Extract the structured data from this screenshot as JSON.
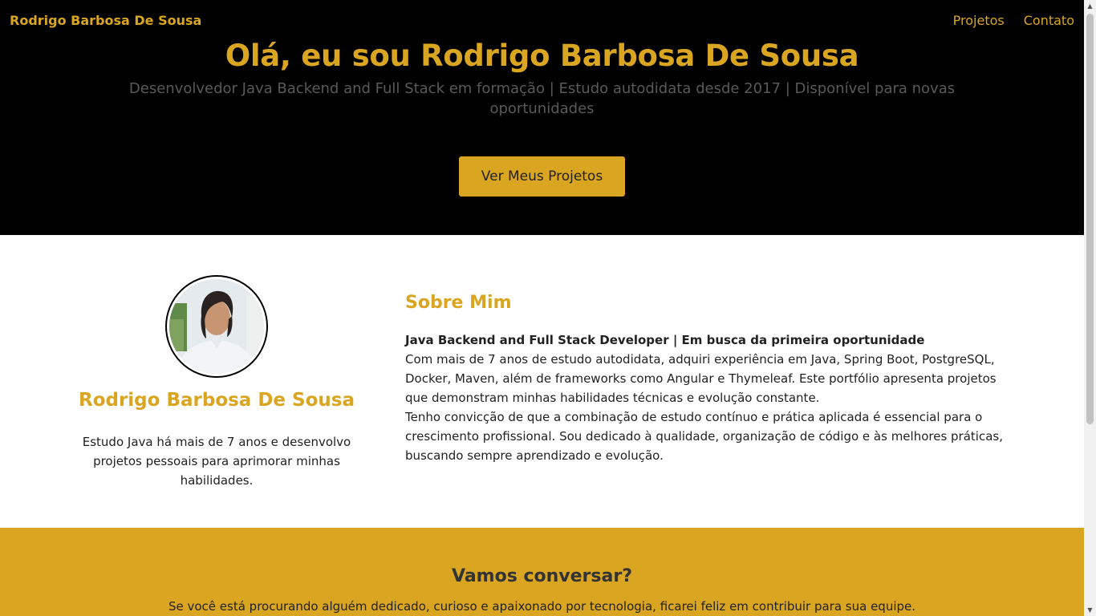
{
  "header": {
    "brand": "Rodrigo Barbosa De Sousa",
    "nav": [
      "Projetos",
      "Contato"
    ]
  },
  "hero": {
    "title": "Olá, eu sou Rodrigo Barbosa De Sousa",
    "subtitle": "Desenvolvedor Java Backend and Full Stack em formação | Estudo autodidata desde 2017 | Disponível para novas oportunidades",
    "cta_label": "Ver Meus Projetos"
  },
  "profile": {
    "name": "Rodrigo Barbosa De Sousa",
    "description": "Estudo Java há mais de 7 anos e desenvolvo projetos pessoais para aprimorar minhas habilidades."
  },
  "about": {
    "title": "Sobre Mim",
    "headline": "Java Backend and Full Stack Developer | Em busca da primeira oportunidade",
    "paragraph1": "Com mais de 7 anos de estudo autodidata, adquiri experiência em Java, Spring Boot, PostgreSQL, Docker, Maven, além de frameworks como Angular e Thymeleaf. Este portfólio apresenta projetos que demonstram minhas habilidades técnicas e evolução constante.",
    "paragraph2": "Tenho convicção de que a combinação de estudo contínuo e prática aplicada é essencial para o crescimento profissional. Sou dedicado à qualidade, organização de código e às melhores práticas, buscando sempre aprendizado e evolução."
  },
  "contact": {
    "title": "Vamos conversar?",
    "text": "Se você está procurando alguém dedicado, curioso e apaixonado por tecnologia, ficarei feliz em contribuir para sua equipe."
  },
  "colors": {
    "accent": "#daa520",
    "hero_bg": "#000000",
    "subtitle": "#595959"
  },
  "icons": {
    "scroll_up": "triangle-up-icon",
    "scroll_down": "triangle-down-icon"
  }
}
